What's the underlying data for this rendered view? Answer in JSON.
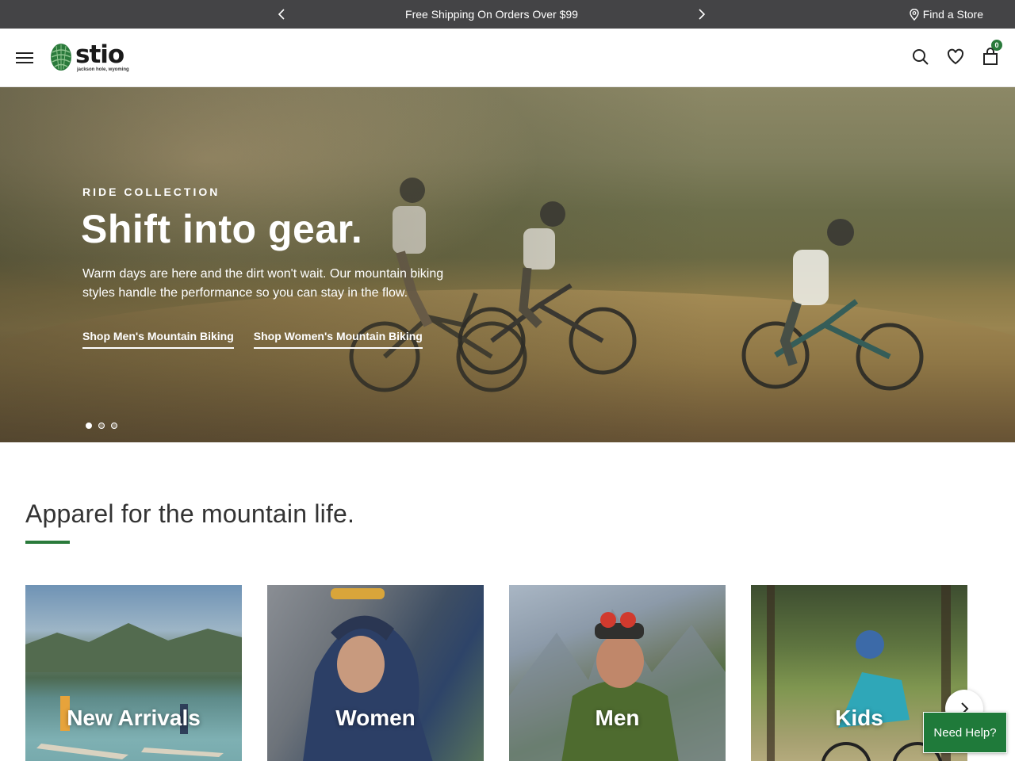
{
  "announcement": {
    "message": "Free Shipping On Orders Over $99",
    "store_link": "Find a Store"
  },
  "header": {
    "logo_text": "stio",
    "logo_tagline": "jackson hole, wyoming",
    "cart_count": "0"
  },
  "hero": {
    "eyebrow": "RIDE COLLECTION",
    "headline": "Shift into gear.",
    "subtext": "Warm days are here and the dirt won't wait. Our mountain biking styles handle the performance so you can stay in the flow.",
    "links": [
      "Shop Men's Mountain Biking",
      "Shop Women's Mountain Biking"
    ],
    "slide_count": 3,
    "active_slide": 1
  },
  "section": {
    "title": "Apparel for the mountain life.",
    "accent_color": "#2a7a3b"
  },
  "categories": [
    {
      "label": "New Arrivals"
    },
    {
      "label": "Women"
    },
    {
      "label": "Men"
    },
    {
      "label": "Kids"
    }
  ],
  "help_button": "Need Help?",
  "icons": [
    "chevron-left-icon",
    "chevron-right-icon",
    "location-pin-icon",
    "menu-icon",
    "pinecone-logo-icon",
    "search-icon",
    "heart-icon",
    "shopping-bag-icon"
  ]
}
